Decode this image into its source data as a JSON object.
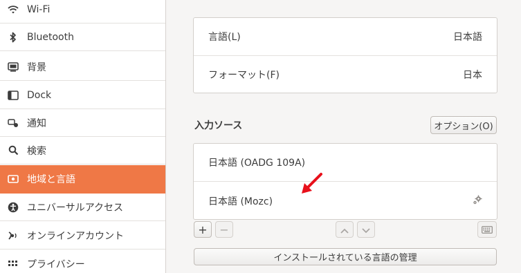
{
  "sidebar": {
    "items": [
      {
        "label": "Wi-Fi",
        "icon": "wifi-icon"
      },
      {
        "label": "Bluetooth",
        "icon": "bluetooth-icon"
      },
      {
        "label": "背景",
        "icon": "background-icon"
      },
      {
        "label": "Dock",
        "icon": "dock-icon"
      },
      {
        "label": "通知",
        "icon": "notification-icon"
      },
      {
        "label": "検索",
        "icon": "search-icon"
      },
      {
        "label": "地域と言語",
        "icon": "region-icon",
        "active": true
      },
      {
        "label": "ユニバーサルアクセス",
        "icon": "accessibility-icon"
      },
      {
        "label": "オンラインアカウント",
        "icon": "online-accounts-icon"
      },
      {
        "label": "プライバシー",
        "icon": "privacy-icon"
      }
    ]
  },
  "region": {
    "language_label": "言語(L)",
    "language_value": "日本語",
    "format_label": "フォーマット(F)",
    "format_value": "日本"
  },
  "input_sources": {
    "title": "入力ソース",
    "options_button": "オプション(O)",
    "items": [
      {
        "label": "日本語 (OADG 109A)"
      },
      {
        "label": "日本語 (Mozc)",
        "has_settings": true
      }
    ],
    "add_button": "+",
    "remove_button": "−",
    "manage_button": "インストールされている言語の管理"
  },
  "colors": {
    "accent": "#ef7846",
    "arrow": "#e8101b"
  }
}
